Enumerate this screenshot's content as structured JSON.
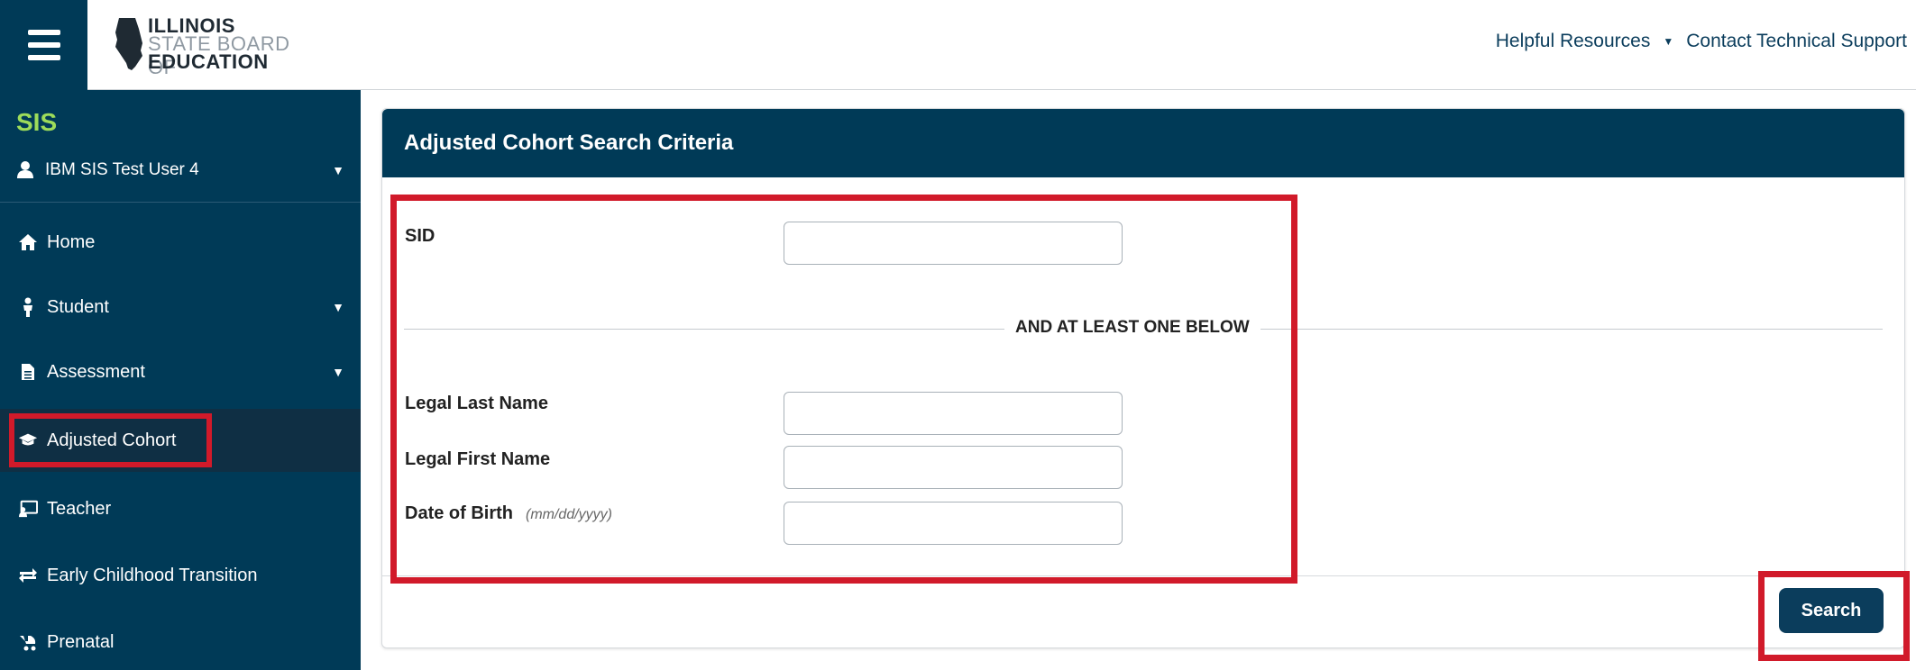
{
  "header": {
    "logo_line1": "ILLINOIS",
    "logo_line2": "STATE BOARD OF",
    "logo_line3": "EDUCATION",
    "links": [
      "Helpful Resources",
      "Contact Technical Support"
    ]
  },
  "sidebar": {
    "app": "SIS",
    "user": "IBM SIS Test User 4",
    "items": [
      {
        "label": "Home",
        "icon": "home-icon"
      },
      {
        "label": "Student",
        "icon": "student-icon"
      },
      {
        "label": "Assessment",
        "icon": "document-icon"
      },
      {
        "label": "Adjusted Cohort",
        "icon": "graduation-cap-icon"
      },
      {
        "label": "Teacher",
        "icon": "teacher-icon"
      },
      {
        "label": "Early Childhood Transition",
        "icon": "transfer-icon"
      },
      {
        "label": "Prenatal",
        "icon": "stroller-icon"
      }
    ]
  },
  "panel": {
    "title": "Adjusted Cohort Search Criteria",
    "sid_label": "SID",
    "sid_value": "",
    "divider_text": "AND AT LEAST ONE BELOW",
    "last_name_label": "Legal Last Name",
    "last_name_value": "",
    "first_name_label": "Legal First Name",
    "first_name_value": "",
    "dob_label": "Date of Birth",
    "dob_hint": "(mm/dd/yyyy)",
    "dob_value": "",
    "search_button": "Search"
  },
  "colors": {
    "brand_navy": "#003a57",
    "sis_green": "#9ddc5a",
    "highlight_red": "#d11a2a"
  }
}
